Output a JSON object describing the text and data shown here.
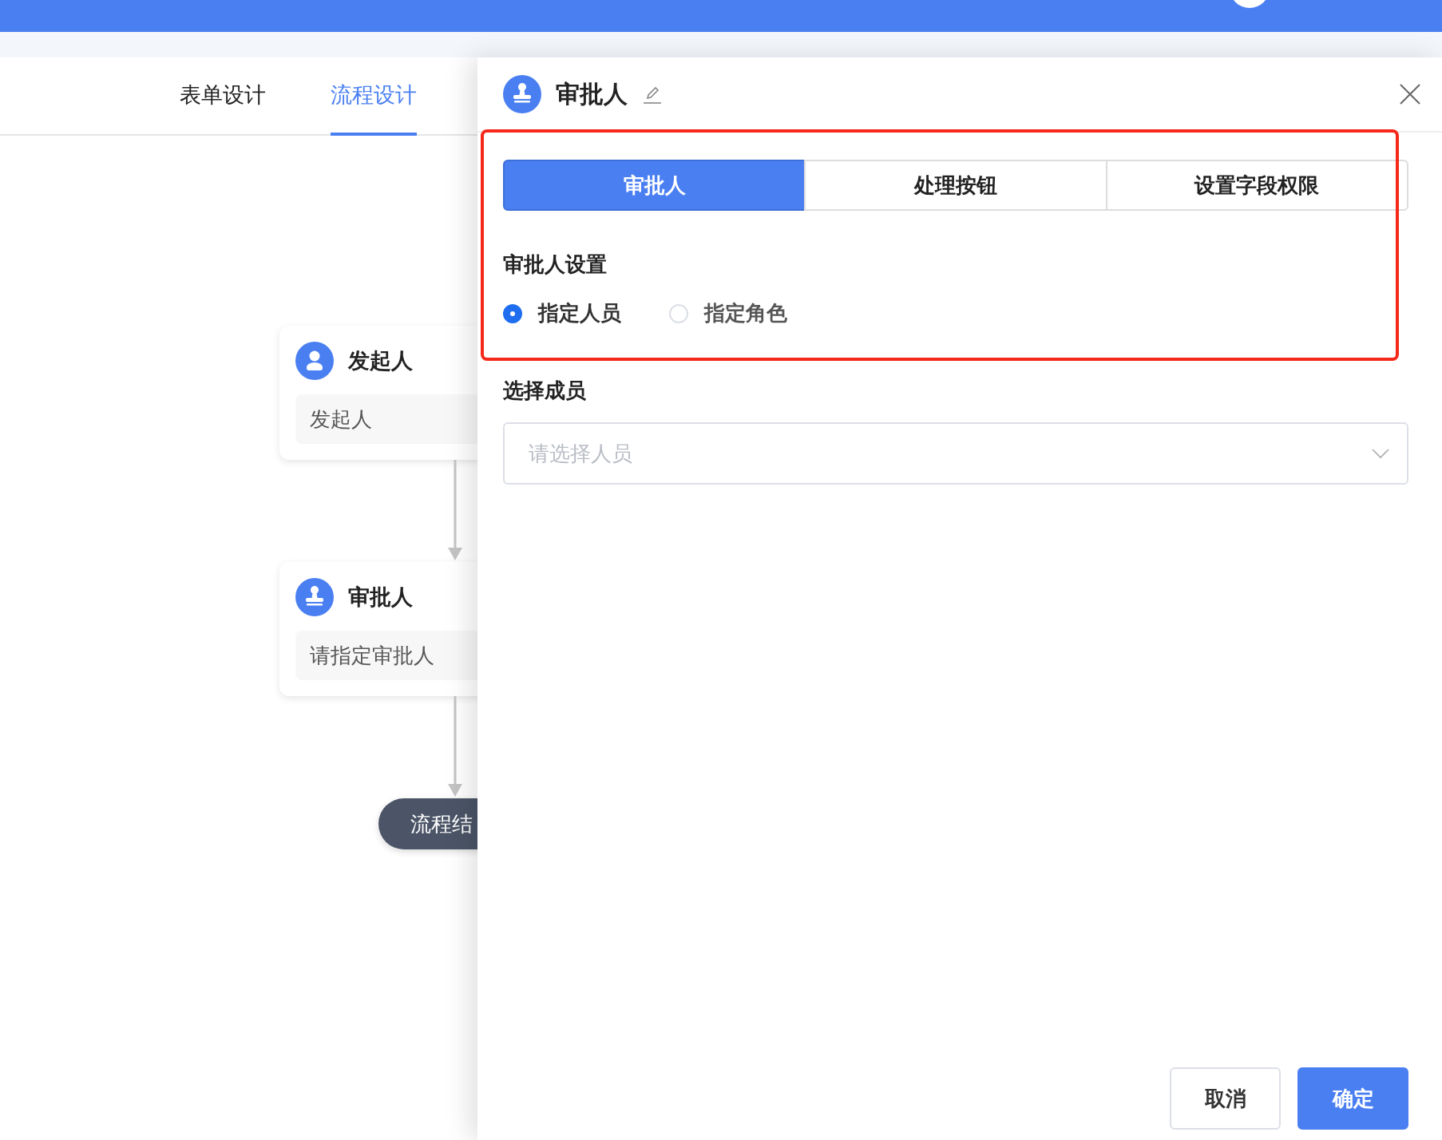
{
  "page_tabs": [
    {
      "label": "表单设计",
      "selected": false
    },
    {
      "label": "流程设计",
      "selected": true
    }
  ],
  "flow": {
    "nodes": [
      {
        "kind": "start",
        "title": "发起人",
        "content": "发起人"
      },
      {
        "kind": "approver",
        "title": "审批人",
        "content": "请指定审批人"
      }
    ],
    "end": {
      "label": "流程结"
    }
  },
  "drawer": {
    "title": "审批人",
    "tabs": [
      {
        "label": "审批人",
        "selected": true
      },
      {
        "label": "处理按钮",
        "selected": false
      },
      {
        "label": "设置字段权限",
        "selected": false
      }
    ],
    "section_title": "审批人设置",
    "options": [
      {
        "label": "指定人员",
        "selected": true
      },
      {
        "label": "指定角色",
        "selected": false
      }
    ],
    "member_label": "选择成员",
    "member_select": {
      "placeholder": "请选择人员"
    },
    "buttons": [
      {
        "label": "取消",
        "kind": "default"
      },
      {
        "label": "确定",
        "kind": "primary"
      }
    ]
  }
}
